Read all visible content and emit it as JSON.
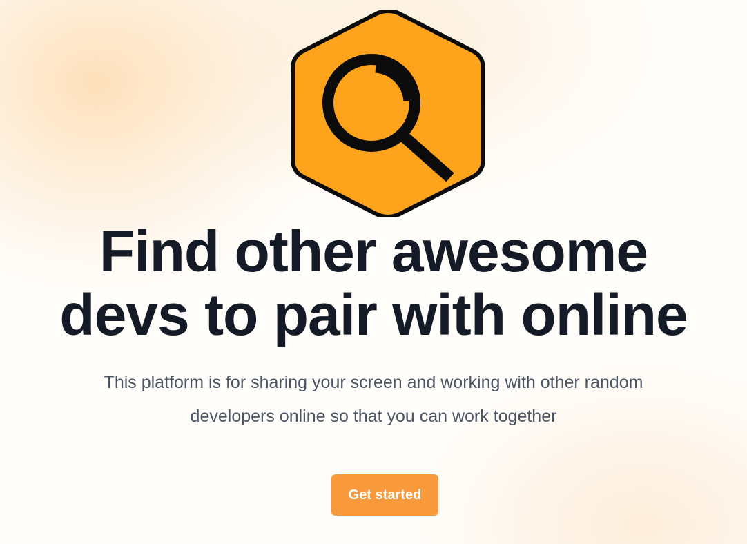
{
  "hero": {
    "logo_icon": "magnifying-glass-hexagon-icon",
    "headline_line1": "Find other awesome",
    "headline_line2": "devs to pair with online",
    "subtitle_line1": "This platform is for sharing your screen and working with other random",
    "subtitle_line2": "developers online so that you can work together",
    "cta_label": "Get started"
  },
  "colors": {
    "accent": "#f89a3c",
    "logo_fill": "#fda31c",
    "heading": "#141a26",
    "body_text": "#4b5563",
    "background_glow": "#fdd7a5"
  }
}
